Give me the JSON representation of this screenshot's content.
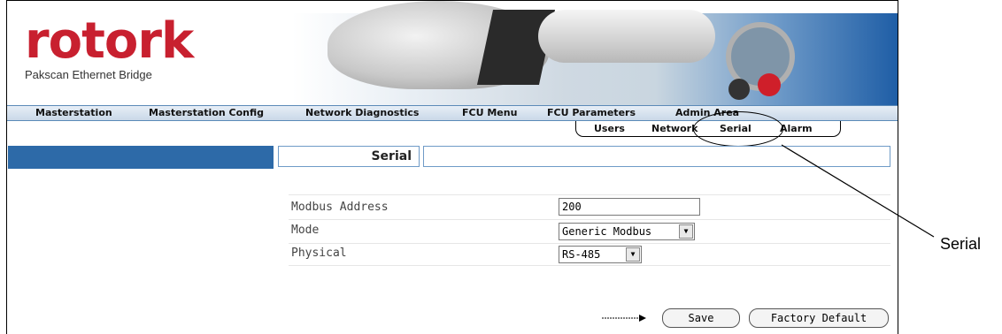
{
  "brand": {
    "logo_text": "rotork",
    "subtitle": "Pakscan Ethernet Bridge"
  },
  "menu": {
    "items": [
      {
        "label": "Masterstation"
      },
      {
        "label": "Masterstation Config"
      },
      {
        "label": "Network Diagnostics"
      },
      {
        "label": "FCU Menu"
      },
      {
        "label": "FCU Parameters"
      },
      {
        "label": "Admin Area"
      }
    ]
  },
  "submenu": {
    "items": [
      {
        "label": "Users"
      },
      {
        "label": "Network"
      },
      {
        "label": "Serial"
      },
      {
        "label": "Alarm"
      }
    ]
  },
  "page": {
    "title": "Serial"
  },
  "form": {
    "modbus_address": {
      "label": "Modbus Address",
      "value": "200"
    },
    "mode": {
      "label": "Mode",
      "value": "Generic Modbus"
    },
    "physical": {
      "label": "Physical",
      "value": "RS-485"
    }
  },
  "buttons": {
    "save": "Save",
    "factory_default": "Factory Default"
  },
  "annotation": {
    "label": "Serial"
  },
  "colors": {
    "brand_red": "#c8202f",
    "title_bar_blue": "#2d6aa8",
    "menu_border_blue": "#5b8ab8"
  }
}
